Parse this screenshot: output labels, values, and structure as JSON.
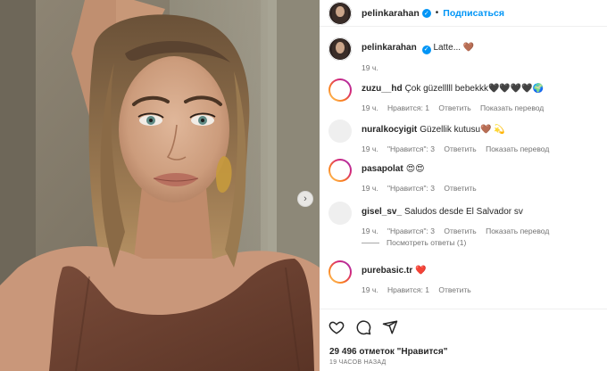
{
  "post": {
    "username": "pelinkarahan",
    "verified_mark": "✓",
    "separator": "•",
    "follow_label": "Подписаться",
    "caption": "Latte... 🤎",
    "caption_time": "19 ч."
  },
  "comments": [
    {
      "user": "zuzu__hd",
      "text": "Çok güzelllll bebekkk🖤🖤🖤🖤🌍",
      "time": "19 ч.",
      "likes": "Нравится: 1",
      "reply": "Ответить",
      "translate": "Показать перевод",
      "avatar": "story-ring"
    },
    {
      "user": "nuralkocyigit",
      "text": "Güzellik kutusu🤎 💫",
      "time": "19 ч.",
      "likes": "\"Нравится\": 3",
      "reply": "Ответить",
      "translate": "Показать перевод",
      "avatar": "grey"
    },
    {
      "user": "pasapolat",
      "text": "😍😍",
      "time": "19 ч.",
      "likes": "\"Нравится\": 3",
      "reply": "Ответить",
      "translate": "",
      "avatar": "story-ring"
    },
    {
      "user": "gisel_sv_",
      "text": "Saludos desde El Salvador sv",
      "time": "19 ч.",
      "likes": "\"Нравится\": 3",
      "reply": "Ответить",
      "translate": "Показать перевод",
      "avatar": "grey"
    },
    {
      "user": "purebasic.tr",
      "text": "❤️",
      "time": "19 ч.",
      "likes": "Нравится: 1",
      "reply": "Ответить",
      "translate": "",
      "avatar": "story-ring"
    }
  ],
  "view_replies": "Посмотреть ответы (1)",
  "footer": {
    "likes": "29 496 отметок \"Нравится\"",
    "time_ago": "19 ЧАСОВ НАЗАД"
  },
  "icons": {
    "like": "heart-icon",
    "comment": "comment-icon",
    "share": "share-icon",
    "save": "bookmark-icon",
    "next": "chevron-right-icon"
  },
  "colors": {
    "accent": "#0095f6",
    "text": "#262626",
    "muted": "#737373",
    "dress": "#6e4536"
  }
}
